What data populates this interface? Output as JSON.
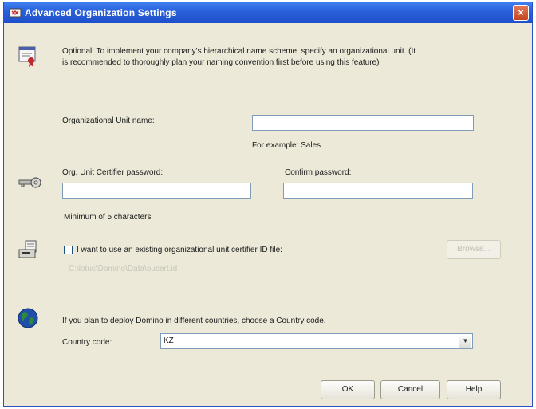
{
  "window": {
    "title": "Advanced Organization Settings",
    "close_glyph": "×"
  },
  "intro": {
    "line1": "Optional: To implement your company's hierarchical name scheme, specify an organizational unit. (It",
    "line2": "is recommended to thoroughly plan your naming convention first before using this feature)"
  },
  "org_unit": {
    "label": "Organizational Unit name:",
    "value": "",
    "example": "For example: Sales"
  },
  "certifier": {
    "password_label": "Org. Unit Certifier password:",
    "confirm_label": "Confirm password:",
    "password_value": "",
    "confirm_value": "",
    "hint": "Minimum of 5 characters"
  },
  "existing_id": {
    "checkbox_label": "I want to use an existing organizational unit certifier ID file:",
    "checked": false,
    "path": "C:\\lotus\\Domino\\Data\\oucert.id",
    "browse_label": "Browse..."
  },
  "country": {
    "prompt": "If you plan to deploy Domino in different countries, choose a Country code.",
    "label": "Country code:",
    "value": "KZ"
  },
  "buttons": {
    "ok": "OK",
    "cancel": "Cancel",
    "help": "Help"
  },
  "icons": [
    "certificate-icon",
    "key-icon",
    "id-file-icon",
    "globe-icon"
  ]
}
